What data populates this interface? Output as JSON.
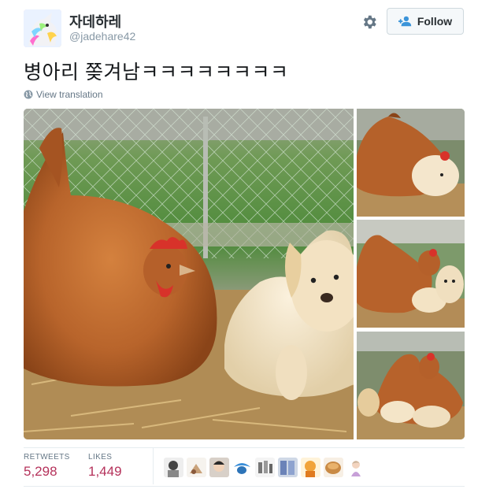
{
  "user": {
    "display_name": "자데하레",
    "handle": "@jadehare42",
    "avatar_icon": "unicorn-avatar"
  },
  "actions": {
    "settings_icon": "gear-icon",
    "follow_label": "Follow",
    "follow_icon": "add-user-icon"
  },
  "tweet": {
    "text": "병아리 쫒겨남ㅋㅋㅋㅋㅋㅋㅋㅋ",
    "translate_label": "View translation",
    "translate_icon": "globe-icon"
  },
  "media": {
    "photos": [
      "hen-and-puppy-main",
      "hen-puppy-thumb-1",
      "hen-puppies-thumb-2",
      "hen-puppies-thumb-3"
    ]
  },
  "stats": {
    "retweets_label": "RETWEETS",
    "retweets_value": "5,298",
    "likes_label": "LIKES",
    "likes_value": "1,449"
  },
  "likers": [
    "liker-1",
    "liker-2",
    "liker-3",
    "liker-4",
    "liker-5",
    "liker-6",
    "liker-7",
    "liker-8",
    "liker-9"
  ],
  "colors": {
    "stat_value": "#b5325b",
    "muted": "#657786",
    "border": "#e6ecf0"
  }
}
